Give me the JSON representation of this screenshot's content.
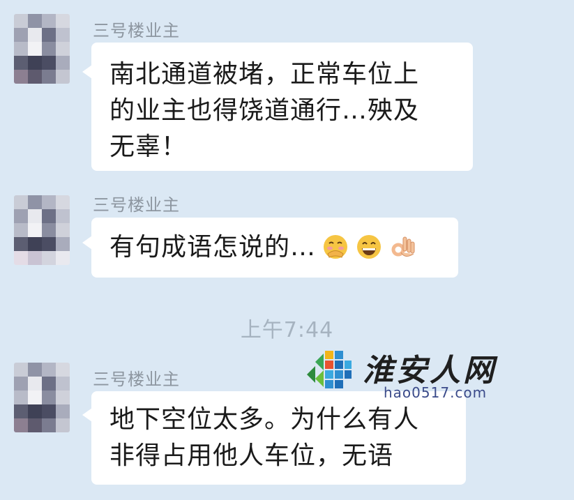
{
  "messages": [
    {
      "sender": "三号楼业主",
      "lines": [
        "南北通道被堵，正常车位上",
        "的业主也得饶道通行…殃及",
        "无辜！"
      ]
    },
    {
      "sender": "三号楼业主",
      "lines": [
        "有句成语怎说的…"
      ],
      "emojis": [
        "face-with-hand-over-mouth-emoji",
        "grinning-face-emoji",
        "ok-hand-emoji"
      ]
    },
    {
      "sender": "三号楼业主",
      "lines": [
        "地下空位太多。为什么有人",
        "非得占用他人车位，无语"
      ]
    }
  ],
  "timestamp": "上午7:44",
  "watermark": {
    "name": "淮安人网",
    "url": "hao0517.com"
  },
  "colors": {
    "background": "#dbe8f4",
    "bubble": "#ffffff",
    "sender_text": "#8d96a0",
    "timestamp_text": "#a6b3c0"
  }
}
